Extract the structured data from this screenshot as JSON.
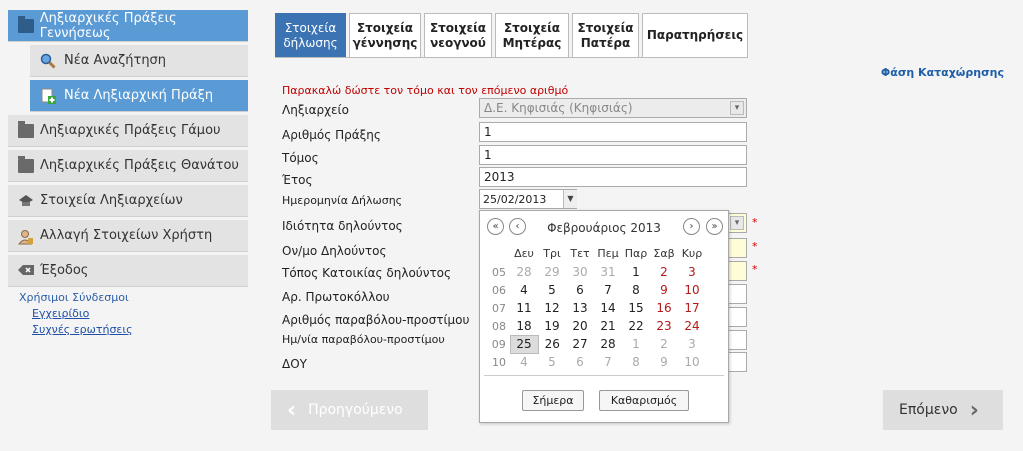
{
  "sidebar": {
    "items": [
      {
        "label": "Ληξιαρχικές Πράξεις Γεννήσεως",
        "icon": "folder-icon"
      },
      {
        "label": "Νέα Αναζήτηση",
        "icon": "search-icon"
      },
      {
        "label": "Νέα Ληξιαρχική Πράξη",
        "icon": "new-document-icon"
      },
      {
        "label": "Ληξιαρχικές Πράξεις Γάμου",
        "icon": "folder-icon"
      },
      {
        "label": "Ληξιαρχικές Πράξεις Θανάτου",
        "icon": "folder-icon"
      },
      {
        "label": "Στοιχεία Ληξιαρχείων",
        "icon": "registry-icon"
      },
      {
        "label": "Αλλαγή Στοιχείων Χρήστη",
        "icon": "user-icon"
      },
      {
        "label": "Έξοδος",
        "icon": "exit-icon"
      }
    ],
    "links_title": "Χρήσιμοι Σύνδεσμοι",
    "links": [
      "Εγχειρίδιο",
      "Συχνές ερωτήσεις"
    ]
  },
  "tabs": [
    {
      "line1": "Στοιχεία",
      "line2": "δήλωσης"
    },
    {
      "line1": "Στοιχεία",
      "line2": "γέννησης"
    },
    {
      "line1": "Στοιχεία",
      "line2": "νεογνού"
    },
    {
      "line1": "Στοιχεία",
      "line2": "Μητέρας"
    },
    {
      "line1": "Στοιχεία",
      "line2": "Πατέρα"
    },
    {
      "line1": "Παρατηρήσεις",
      "line2": ""
    }
  ],
  "phase": "Φάση Καταχώρησης",
  "error": "Παρακαλώ δώστε τον τόμο και τον επόμενο αριθμό",
  "form": {
    "registry_label": "Ληξιαρχείο",
    "registry_value": "Δ.Ε. Κηφισιάς (Κηφισιάς)",
    "act_number_label": "Αριθμός Πράξης",
    "act_number_value": "1",
    "volume_label": "Τόμος",
    "volume_value": "1",
    "year_label": "Έτος",
    "year_value": "2013",
    "decl_date_label": "Ημερομηνία Δήλωσης",
    "decl_date_value": "25/02/2013",
    "declarant_capacity_label": "Ιδιότητα δηλούντος",
    "declarant_name_label": "Ον/μο Δηλούντος",
    "declarant_residence_label": "Τόπος Κατοικίας δηλούντος",
    "protocol_label": "Αρ. Πρωτοκόλλου",
    "fee_number_label": "Αριθμός παραβόλου-προστίμου",
    "fee_date_label": "Ημ/νία παραβόλου-προστίμου",
    "tax_office_label": "ΔΟΥ"
  },
  "calendar": {
    "month": "Φεβρουάριος 2013",
    "weekdays": [
      "Δευ",
      "Τρι",
      "Τετ",
      "Πεμ",
      "Παρ",
      "Σαβ",
      "Κυρ"
    ],
    "weeks": [
      {
        "wk": "05",
        "days": [
          "28",
          "29",
          "30",
          "31",
          "1",
          "2",
          "3"
        ]
      },
      {
        "wk": "06",
        "days": [
          "4",
          "5",
          "6",
          "7",
          "8",
          "9",
          "10"
        ]
      },
      {
        "wk": "07",
        "days": [
          "11",
          "12",
          "13",
          "14",
          "15",
          "16",
          "17"
        ]
      },
      {
        "wk": "08",
        "days": [
          "18",
          "19",
          "20",
          "21",
          "22",
          "23",
          "24"
        ]
      },
      {
        "wk": "09",
        "days": [
          "25",
          "26",
          "27",
          "28",
          "1",
          "2",
          "3"
        ]
      },
      {
        "wk": "10",
        "days": [
          "4",
          "5",
          "6",
          "7",
          "8",
          "9",
          "10"
        ]
      }
    ],
    "today_label": "Σήμερα",
    "clear_label": "Καθαρισμός"
  },
  "nav": {
    "prev_label": "Προηγούμενο",
    "next_label": "Επόμενο"
  }
}
